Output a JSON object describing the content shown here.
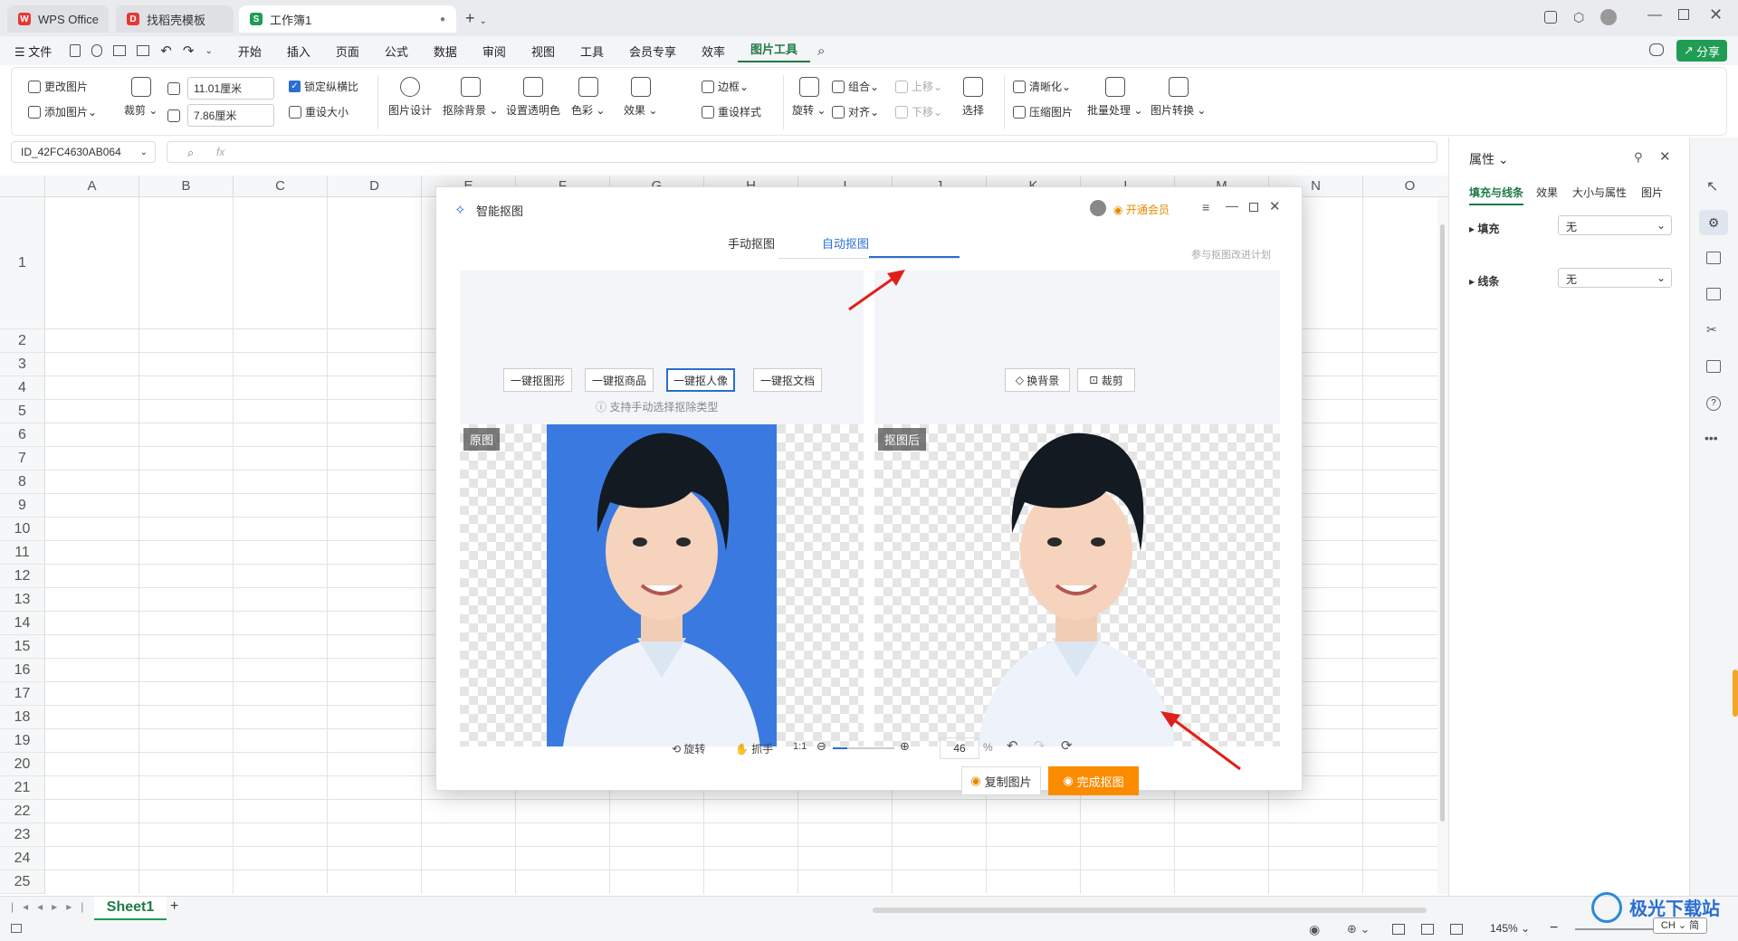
{
  "tabs": [
    {
      "label": "WPS Office",
      "icon": "wps-logo-icon",
      "color": "#e53935"
    },
    {
      "label": "找稻壳模板",
      "icon": "docer-icon",
      "color": "#e53935"
    },
    {
      "label": "工作簿1",
      "icon": "spreadsheet-icon",
      "color": "#1f9d55"
    }
  ],
  "menu": {
    "file": "文件",
    "items": [
      "开始",
      "插入",
      "页面",
      "公式",
      "数据",
      "审阅",
      "视图",
      "工具",
      "会员专享",
      "效率",
      "图片工具"
    ],
    "share": "分享"
  },
  "ribbon": {
    "change_pic": "更改图片",
    "add_pic": "添加图片",
    "crop": "裁剪",
    "width": "11.01厘米",
    "height": "7.86厘米",
    "lock_ratio": "锁定纵横比",
    "reset_size": "重设大小",
    "pic_design": "图片设计",
    "remove_bg": "抠除背景",
    "set_transparent": "设置透明色",
    "color": "色彩",
    "effects": "效果",
    "reset_style": "重设样式",
    "border": "边框",
    "rotate": "旋转",
    "group": "组合",
    "align": "对齐",
    "bring_up": "上移",
    "send_down": "下移",
    "select": "选择",
    "sharpen": "清晰化",
    "compress": "压缩图片",
    "batch": "批量处理",
    "convert": "图片转换"
  },
  "formula": {
    "name_box": "ID_42FC4630AB064",
    "fx": "fx"
  },
  "columns": [
    "A",
    "B",
    "C",
    "D",
    "E",
    "F",
    "G",
    "H",
    "I",
    "J",
    "K",
    "L",
    "M",
    "N",
    "O"
  ],
  "rows": [
    "1",
    "2",
    "3",
    "4",
    "5",
    "6",
    "7",
    "8",
    "9",
    "10",
    "11",
    "12",
    "13",
    "14",
    "15",
    "16",
    "17",
    "18",
    "19",
    "20",
    "21",
    "22",
    "23",
    "24",
    "25"
  ],
  "sheet": {
    "name": "Sheet1",
    "add": "+"
  },
  "right_panel": {
    "title": "属性",
    "tabs": [
      "填充与线条",
      "效果",
      "大小与属性",
      "图片"
    ],
    "fill_label": "填充",
    "fill_value": "无",
    "line_label": "线条",
    "line_value": "无"
  },
  "status": {
    "zoom": "145%"
  },
  "dialog": {
    "title": "智能抠图",
    "vip": "开通会员",
    "tab_manual": "手动抠图",
    "tab_auto": "自动抠图",
    "join_plan": "参与抠图改进计划",
    "options": [
      "一键抠图形",
      "一键抠商品",
      "一键抠人像",
      "一键抠文档"
    ],
    "hint": "支持手动选择抠除类型",
    "change_bg": "换背景",
    "crop": "裁剪",
    "original_label": "原图",
    "after_label": "抠图后",
    "copy_pic": "复制图片",
    "finish": "完成抠图",
    "rotate": "旋转",
    "hand": "抓手",
    "ratio": "1:1",
    "zoom_value": "46",
    "percent": "%"
  },
  "watermark": "极光下载站"
}
